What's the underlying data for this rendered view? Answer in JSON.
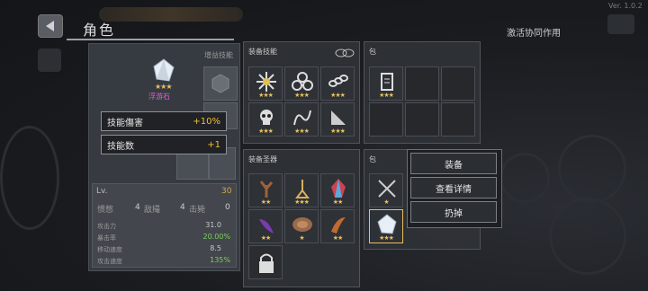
{
  "header": {
    "title": "角色",
    "version": "Ver. 1.0.2",
    "synergy_label": "激活协同作用"
  },
  "character": {
    "gem_name": "浮游石",
    "gem_stars": "★★★",
    "skill_side_label": "增益技能",
    "tooltip": [
      {
        "label": "技能傷害",
        "value": "+10%"
      },
      {
        "label": "技能数",
        "value": "+1"
      }
    ],
    "level_label": "Lv.",
    "level_value": "30",
    "kills_label": "惯憋",
    "kills_value": "4",
    "kills_unit": "敌撮",
    "other_value": "4",
    "other_unit": "击毙",
    "zero": "0",
    "stats": [
      {
        "label": "攻击力",
        "value": "31.0",
        "green": false
      },
      {
        "label": "暴击率",
        "value": "20.00%",
        "green": true
      },
      {
        "label": "移动速度",
        "value": "8.5",
        "green": false
      },
      {
        "label": "攻击速度",
        "value": "135%",
        "green": true
      }
    ]
  },
  "skills_panel": {
    "title": "装备技能",
    "slots": [
      {
        "icon": "burst-icon",
        "stars": "★★★"
      },
      {
        "icon": "biohazard-icon",
        "stars": "★★★"
      },
      {
        "icon": "chain-icon",
        "stars": "★★★"
      },
      {
        "icon": "skull-icon",
        "stars": "★★★"
      },
      {
        "icon": "tentacle-icon",
        "stars": "★★★"
      },
      {
        "icon": "blade-icon",
        "stars": "★★★"
      }
    ]
  },
  "bag_top": {
    "title": "包",
    "slots": [
      {
        "icon": "scroll-icon",
        "stars": "★★★"
      }
    ]
  },
  "relics_panel": {
    "title": "装备圣器",
    "slots": [
      {
        "icon": "branch-icon",
        "stars": "★★"
      },
      {
        "icon": "pendulum-icon",
        "stars": "★★★"
      },
      {
        "icon": "crystal-icon",
        "stars": "★★"
      },
      {
        "icon": "claw-icon",
        "stars": "★★"
      },
      {
        "icon": "meat-icon",
        "stars": "★"
      },
      {
        "icon": "horn-icon",
        "stars": "★★"
      }
    ]
  },
  "bag_bottom": {
    "title": "包",
    "slots": [
      {
        "icon": "crossed-swords-icon",
        "stars": "★"
      },
      {
        "icon": "white-gem-icon",
        "stars": "★★★"
      }
    ]
  },
  "context_menu": {
    "equip": "装备",
    "details": "查看详情",
    "discard": "扔掉"
  },
  "colors": {
    "accent_gold": "#e6c060",
    "tooltip_value": "#f0c030",
    "gem_name": "#e060d0",
    "green_stat": "#7ad05a"
  }
}
